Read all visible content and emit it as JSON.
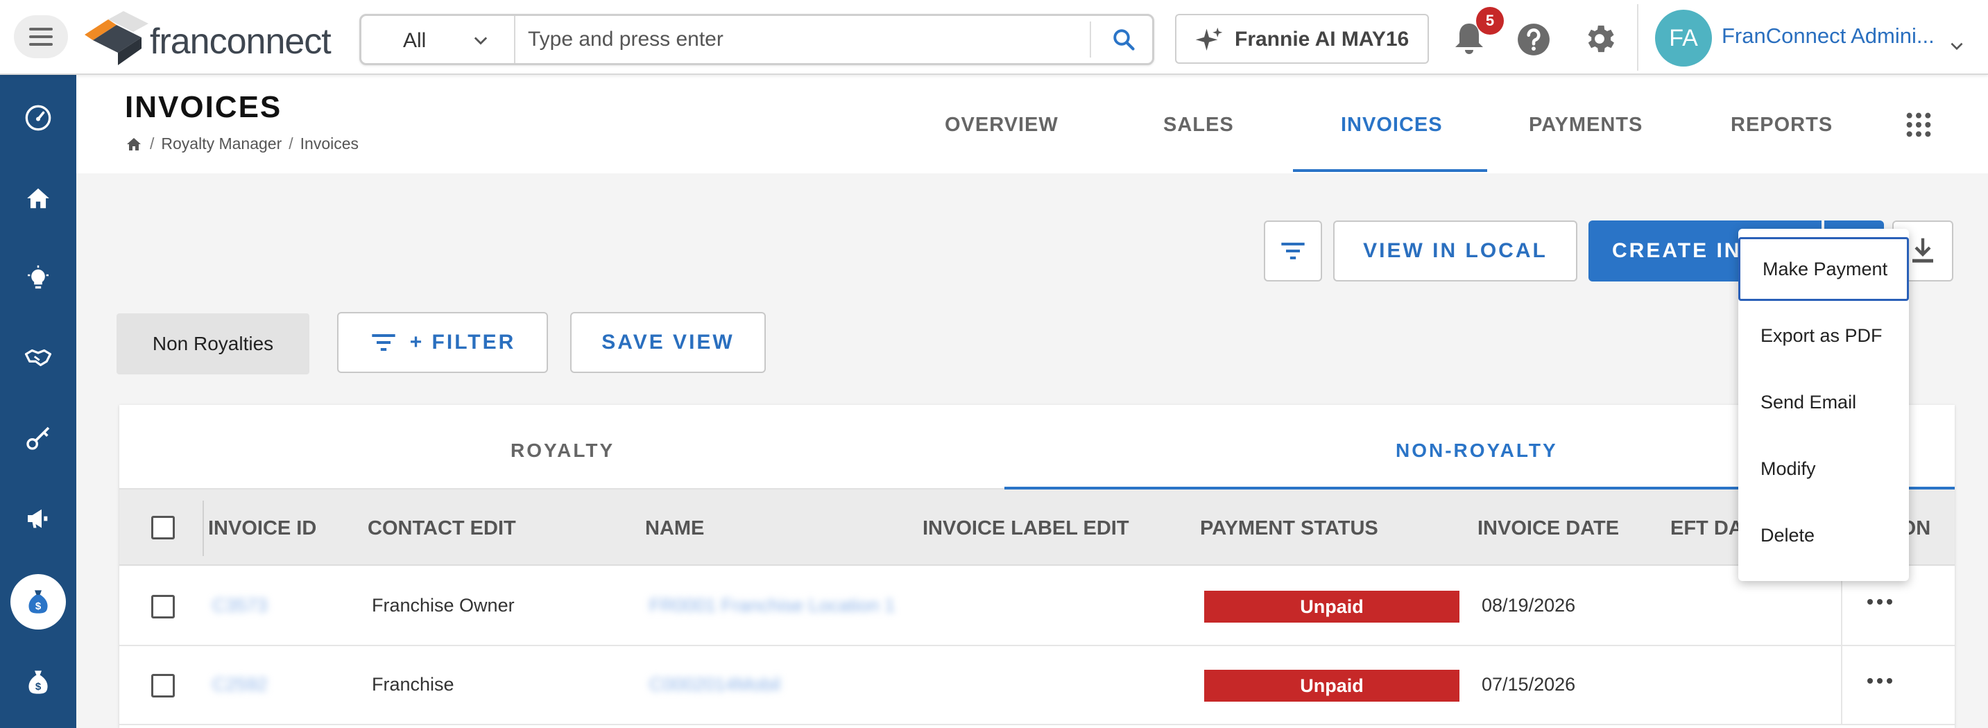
{
  "topbar": {
    "brand": "franconnect",
    "search_scope": "All",
    "search_placeholder": "Type and press enter",
    "ai_button_label": "Frannie AI MAY16",
    "notification_count": "5",
    "user_initials": "FA",
    "user_name": "FranConnect Admini..."
  },
  "page": {
    "title": "INVOICES",
    "breadcrumb": [
      "Royalty Manager",
      "Invoices"
    ],
    "tabs": [
      "OVERVIEW",
      "SALES",
      "INVOICES",
      "PAYMENTS",
      "REPORTS"
    ],
    "active_tab": "INVOICES"
  },
  "actions": {
    "view_in_local": "VIEW IN LOCAL",
    "create_invoice": "CREATE INVOICE",
    "view_chip": "Non Royalties",
    "filter": "+ FILTER",
    "save_view": "SAVE VIEW"
  },
  "subtabs": [
    "ROYALTY",
    "NON-ROYALTY"
  ],
  "active_subtab": "NON-ROYALTY",
  "table": {
    "columns": [
      "INVOICE ID",
      "CONTACT EDIT",
      "NAME",
      "INVOICE LABEL EDIT",
      "PAYMENT STATUS",
      "INVOICE DATE",
      "EFT DATE",
      "ACTION"
    ],
    "rows": [
      {
        "invoice_id": "C3573",
        "contact": "Franchise Owner",
        "name": "FR0001 Franchise Location 1",
        "label": "",
        "status": "Unpaid",
        "date": "08/19/2026"
      },
      {
        "invoice_id": "C2592",
        "contact": "Franchise",
        "name": "C0002014Mobil",
        "label": "",
        "status": "Unpaid",
        "date": "07/15/2026"
      }
    ]
  },
  "row_menu": {
    "items": [
      "Make Payment",
      "Export as PDF",
      "Send Email",
      "Modify",
      "Delete"
    ]
  },
  "colors": {
    "primary": "#2a74c7",
    "nav": "#1d4d7e",
    "unpaid": "#c62828",
    "avatar": "#4fb3c2"
  }
}
